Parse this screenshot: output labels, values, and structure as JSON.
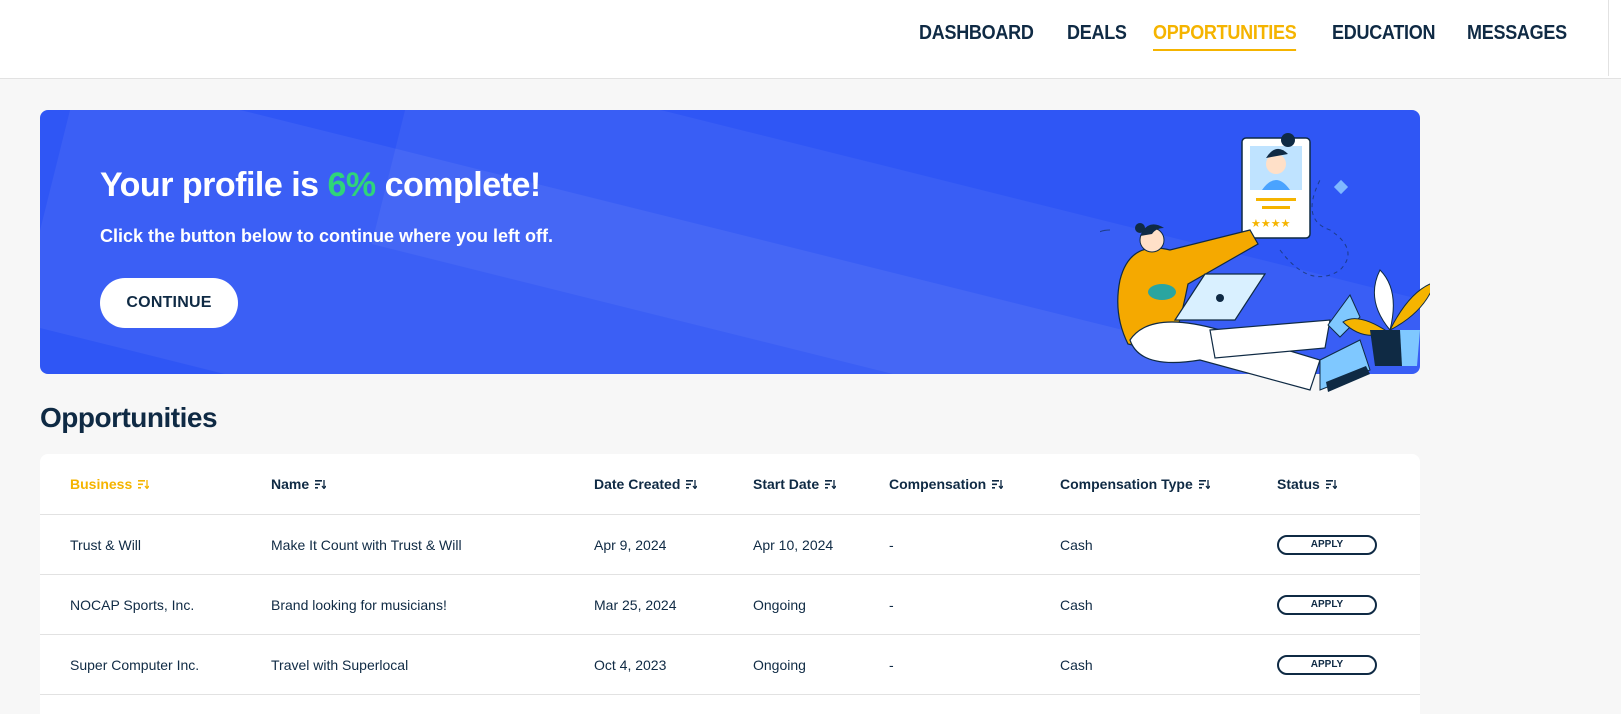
{
  "nav": {
    "items": [
      {
        "label": "DASHBOARD",
        "active": false
      },
      {
        "label": "DEALS",
        "active": false
      },
      {
        "label": "OPPORTUNITIES",
        "active": true
      },
      {
        "label": "EDUCATION",
        "active": false
      },
      {
        "label": "MESSAGES",
        "active": false
      }
    ]
  },
  "banner": {
    "title_prefix": "Your profile is ",
    "percent": "6%",
    "title_suffix": " complete!",
    "subtitle": "Click the button below to continue where you left off.",
    "continue_label": "CONTINUE",
    "colors": {
      "background": "#2f56f5",
      "percent": "#2fd47a"
    }
  },
  "section": {
    "title": "Opportunities"
  },
  "table": {
    "columns": [
      "Business",
      "Name",
      "Date Created",
      "Start Date",
      "Compensation",
      "Compensation Type",
      "Status"
    ],
    "active_sort_column": "Business",
    "rows": [
      {
        "business": "Trust & Will",
        "name": "Make It Count with Trust & Will",
        "date_created": "Apr 9, 2024",
        "start_date": "Apr 10, 2024",
        "compensation": "-",
        "compensation_type": "Cash",
        "status": "APPLY"
      },
      {
        "business": "NOCAP Sports, Inc.",
        "name": "Brand looking for musicians!",
        "date_created": "Mar 25, 2024",
        "start_date": "Ongoing",
        "compensation": "-",
        "compensation_type": "Cash",
        "status": "APPLY"
      },
      {
        "business": "Super Computer Inc.",
        "name": "Travel with Superlocal",
        "date_created": "Oct 4, 2023",
        "start_date": "Ongoing",
        "compensation": "-",
        "compensation_type": "Cash",
        "status": "APPLY"
      }
    ]
  },
  "colors": {
    "accent": "#f5b400",
    "navy": "#0f2a44"
  }
}
